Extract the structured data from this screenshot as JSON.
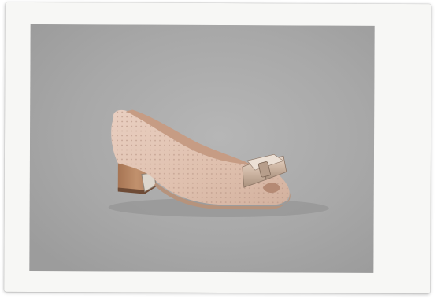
{
  "image": {
    "subject": "shoe-photo",
    "colors": {
      "background": "#a8a8a8",
      "frame": "#f7f7f5",
      "shoe_upper": "#e3c6b6",
      "shoe_lining": "#c9a089",
      "heel": "#b78662",
      "bow_metal": "#c8b8a8"
    }
  }
}
